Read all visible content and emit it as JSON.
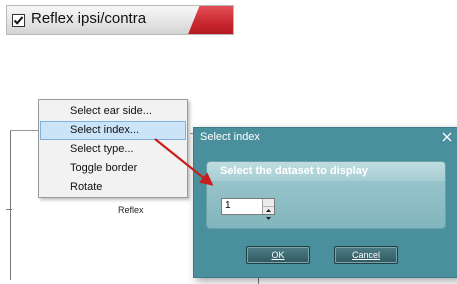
{
  "checkbox_bar": {
    "label": "Reflex ipsi/contra",
    "checked": true,
    "accent_color": "#c8262e"
  },
  "plot": {
    "label": "Reflex"
  },
  "context_menu": {
    "items": [
      {
        "label": "Select ear side..."
      },
      {
        "label": "Select index..."
      },
      {
        "label": "Select type..."
      },
      {
        "label": "Toggle border"
      },
      {
        "label": "Rotate"
      }
    ],
    "highlighted_index": 1,
    "highlight_color": "#cce4f7"
  },
  "dialog": {
    "title": "Select index",
    "close_icon": "close-icon",
    "panel_title": "Select the dataset to display",
    "index_value": "1",
    "ok_label": "OK",
    "cancel_label": "Cancel",
    "background_color": "#4a8f9c"
  },
  "annotation": {
    "arrow_color": "#c81e1e"
  }
}
